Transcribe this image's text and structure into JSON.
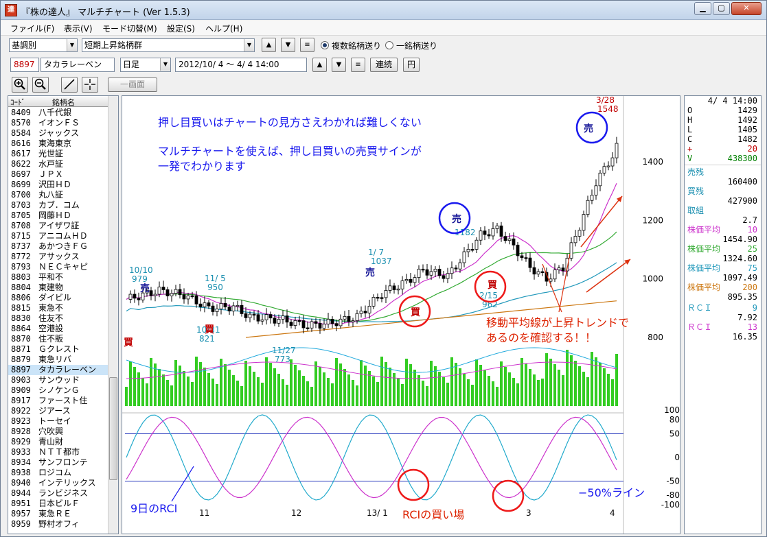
{
  "window": {
    "title": "『株の達人』 マルチチャート  (Ver 1.5.3)",
    "icon_char": "達"
  },
  "menu": [
    "ファイル(F)",
    "表示(V)",
    "モード切替(M)",
    "設定(S)",
    "ヘルプ(H)"
  ],
  "toolbar1": {
    "category": "基調別",
    "group": "短期上昇銘柄群",
    "radio_multi": "複数銘柄送り",
    "radio_single": "一銘柄送り"
  },
  "toolbar2": {
    "code": "8897",
    "name": "タカラレーベン",
    "period": "日足",
    "date_range": "2012/10/ 4 ～  4/ 4 14:00",
    "btn_continuous": "連続",
    "btn_yen": "円"
  },
  "toolbar3": {
    "btn_one_screen": "一画面"
  },
  "stock_list": {
    "header_code": "ｺｰﾄﾞ",
    "header_name": "銘柄名",
    "rows": [
      [
        "8409",
        "八千代銀"
      ],
      [
        "8570",
        "イオンＦＳ"
      ],
      [
        "8584",
        "ジャックス"
      ],
      [
        "8616",
        "東海東京"
      ],
      [
        "8617",
        "光世証"
      ],
      [
        "8622",
        "水戸証"
      ],
      [
        "8697",
        "ＪＰＸ"
      ],
      [
        "8699",
        "沢田ＨＤ"
      ],
      [
        "8700",
        "丸八証"
      ],
      [
        "8703",
        "カブ．コム"
      ],
      [
        "8705",
        "岡藤ＨＤ"
      ],
      [
        "8708",
        "アイザワ証"
      ],
      [
        "8715",
        "アニコムＨＤ"
      ],
      [
        "8737",
        "あかつきＦＧ"
      ],
      [
        "8772",
        "アサックス"
      ],
      [
        "8793",
        "ＮＥＣキャピ"
      ],
      [
        "8803",
        "平和不"
      ],
      [
        "8804",
        "東建物"
      ],
      [
        "8806",
        "ダイビル"
      ],
      [
        "8815",
        "東急不"
      ],
      [
        "8830",
        "住友不"
      ],
      [
        "8864",
        "空港設"
      ],
      [
        "8870",
        "住不販"
      ],
      [
        "8871",
        "Ｇクレスト"
      ],
      [
        "8879",
        "東急リバ"
      ],
      [
        "8897",
        "タカラレーベン"
      ],
      [
        "8903",
        "サンウッド"
      ],
      [
        "8909",
        "シノケンＧ"
      ],
      [
        "8917",
        "ファースト住"
      ],
      [
        "8922",
        "ジアース"
      ],
      [
        "8923",
        "トーセイ"
      ],
      [
        "8928",
        "穴吹興"
      ],
      [
        "8929",
        "青山財"
      ],
      [
        "8933",
        "ＮＴＴ都市"
      ],
      [
        "8934",
        "サンフロンテ"
      ],
      [
        "8938",
        "ロジコム"
      ],
      [
        "8940",
        "インテリックス"
      ],
      [
        "8944",
        "ランビジネス"
      ],
      [
        "8951",
        "日本ビルＦ"
      ],
      [
        "8957",
        "東急ＲＥ"
      ],
      [
        "8959",
        "野村オフィ"
      ]
    ],
    "selected_index": 25
  },
  "info_panel": {
    "datetime": "4/ 4 14:00",
    "ohlc": [
      [
        "O",
        "1429"
      ],
      [
        "H",
        "1492"
      ],
      [
        "L",
        "1405"
      ],
      [
        "C",
        "1482"
      ],
      [
        "+",
        "20"
      ],
      [
        "V",
        "438300"
      ]
    ],
    "sell_remain_label": "売残",
    "sell_remain": "160400",
    "buy_remain_label": "買残",
    "buy_remain": "427900",
    "ratio_label": "取組",
    "ratio": "2.7",
    "ma": [
      {
        "label": "株価平均",
        "period": "10",
        "value": "1454.90",
        "color": "#cc33cc"
      },
      {
        "label": "株価平均",
        "period": "25",
        "value": "1324.60",
        "color": "#33aa33"
      },
      {
        "label": "株価平均",
        "period": "75",
        "value": "1097.49",
        "color": "#2299bb"
      },
      {
        "label": "株価平均",
        "period": "200",
        "value": "895.35",
        "color": "#cc7711"
      }
    ],
    "rci": [
      {
        "label": "ＲＣＩ",
        "period": "9",
        "value": "7.92",
        "color": "#2299bb"
      },
      {
        "label": "ＲＣＩ",
        "period": "13",
        "value": "16.35",
        "color": "#cc33cc"
      }
    ]
  },
  "chart_data": {
    "type": "candlestick",
    "price_axis": [
      1400,
      1200,
      1000,
      800
    ],
    "rci_axis": [
      100,
      80,
      50,
      0,
      -50,
      -80,
      -100
    ],
    "x_ticks": [
      "11",
      "12",
      "13/ 1",
      "3",
      "4"
    ],
    "price_annotations": [
      {
        "date": "10/10",
        "value": "979"
      },
      {
        "date": "11/ 5",
        "value": "950"
      },
      {
        "date": "10/31",
        "value": "821"
      },
      {
        "date": "11/27",
        "value": "773"
      },
      {
        "date": "1/ 7",
        "value": "1037"
      },
      {
        "date": "",
        "value": "1182"
      },
      {
        "date": "2/15",
        "value": "962"
      },
      {
        "date": "3/28",
        "value": "1548"
      }
    ],
    "signals": {
      "sell": "売",
      "buy": "買"
    },
    "ma_colors": {
      "ma10": "#cc33cc",
      "ma25": "#33aa33",
      "ma75": "#2299bb",
      "ma200": "#cc7711"
    },
    "overlay_text": {
      "headline": "押し目買いはチャートの見方さえわかれば難しくない",
      "line2": "マルチチャートを使えば、押し目買いの売買サインが",
      "line3": "一発でわかります",
      "trend_note1": "移動平均線が上昇トレンドで",
      "trend_note2": "あるのを確認する！！",
      "rci9_label": "9日のRCI",
      "rci_buy_label": "RCIの買い場",
      "minus50_label": "−50%ライン"
    }
  }
}
